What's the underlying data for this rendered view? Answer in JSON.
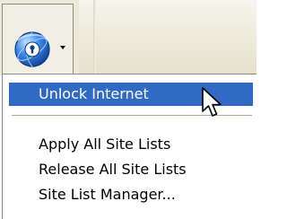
{
  "toolbar": {
    "button": {
      "icon": "globe-lock-icon",
      "dropdown_icon": "dropdown-arrow-icon"
    },
    "colors": {
      "background": "#ece9d8",
      "button_border": "#8e8e80"
    }
  },
  "menu": {
    "items": [
      {
        "label": "Unlock Internet",
        "highlighted": true
      },
      {
        "label": "Apply All Site Lists",
        "highlighted": false
      },
      {
        "label": "Release All Site Lists",
        "highlighted": false
      },
      {
        "label": "Site List Manager...",
        "highlighted": false
      }
    ],
    "colors": {
      "highlight": "#316ac5",
      "highlight_text": "#ffffff",
      "separator": "#aca899"
    }
  },
  "cursor": {
    "icon": "arrow-cursor-icon"
  }
}
